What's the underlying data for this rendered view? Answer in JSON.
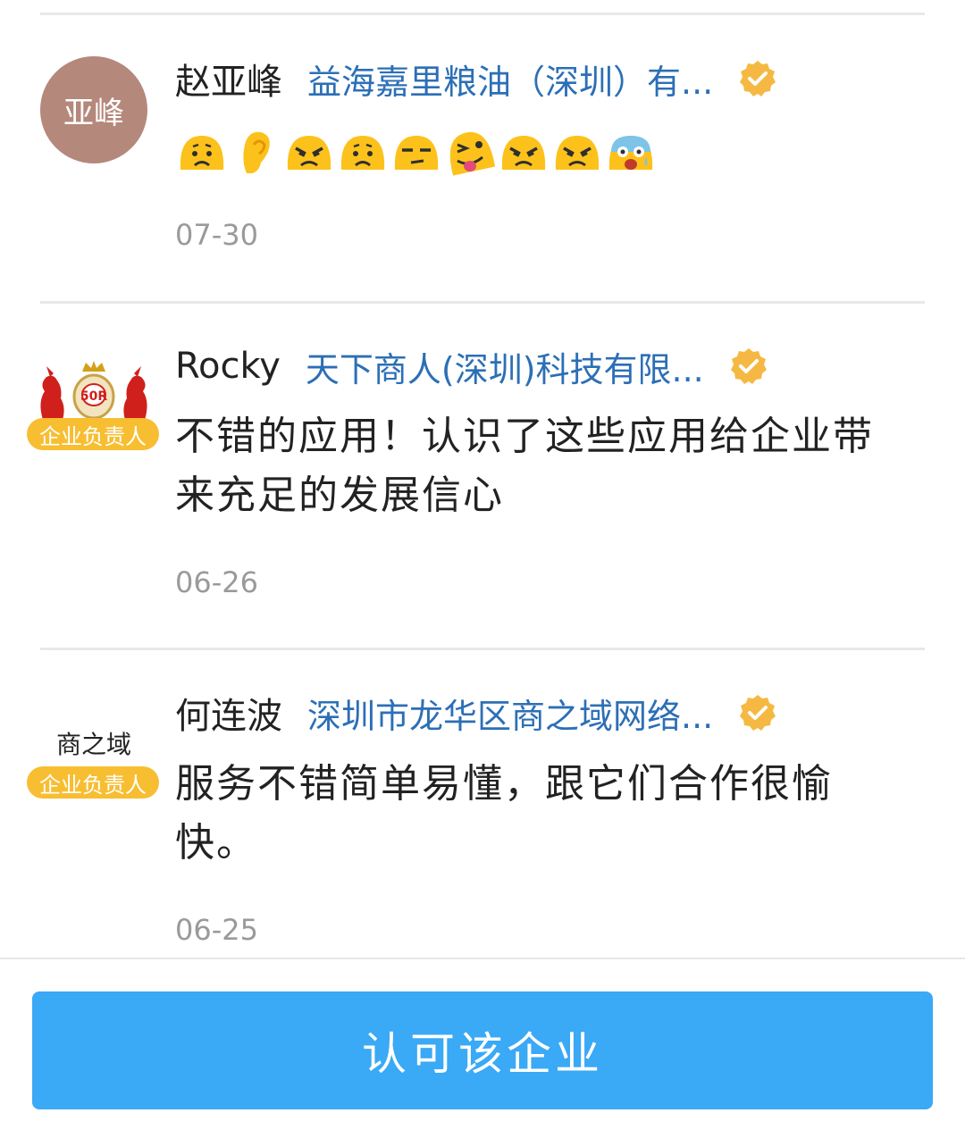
{
  "comments": [
    {
      "user": "赵亚峰",
      "avatar_text": "亚峰",
      "company": "益海嘉里粮油（深圳）有...",
      "emojis": [
        "frowning-face",
        "ear",
        "angry-face",
        "frowning-face",
        "unamused-face",
        "winking-tongue-face",
        "angry-face",
        "angry-face",
        "screaming-face"
      ],
      "date": "07-30"
    },
    {
      "user": "Rocky",
      "avatar_logo_text": "50R",
      "role_badge": "企业负责人",
      "company": "天下商人(深圳)科技有限...",
      "text_line1": "不错的应用！认识了这些应用给企业带",
      "text_line2": "来充足的发展信心",
      "date": "06-26"
    },
    {
      "user": "何连波",
      "avatar_logo_text": "商之域",
      "role_badge": "企业负责人",
      "company": "深圳市龙华区商之域网络...",
      "text_line1": "服务不错简单易懂，跟它们合作很愉",
      "text_line2": "快。",
      "date": "06-25"
    }
  ],
  "verified_icon": "verified-badge-icon",
  "colors": {
    "accent": "#3aa9f6",
    "company_link": "#2c6fb6",
    "badge": "#f7be32",
    "verified": "#f5b943"
  },
  "footer": {
    "approve_label": "认可该企业"
  }
}
